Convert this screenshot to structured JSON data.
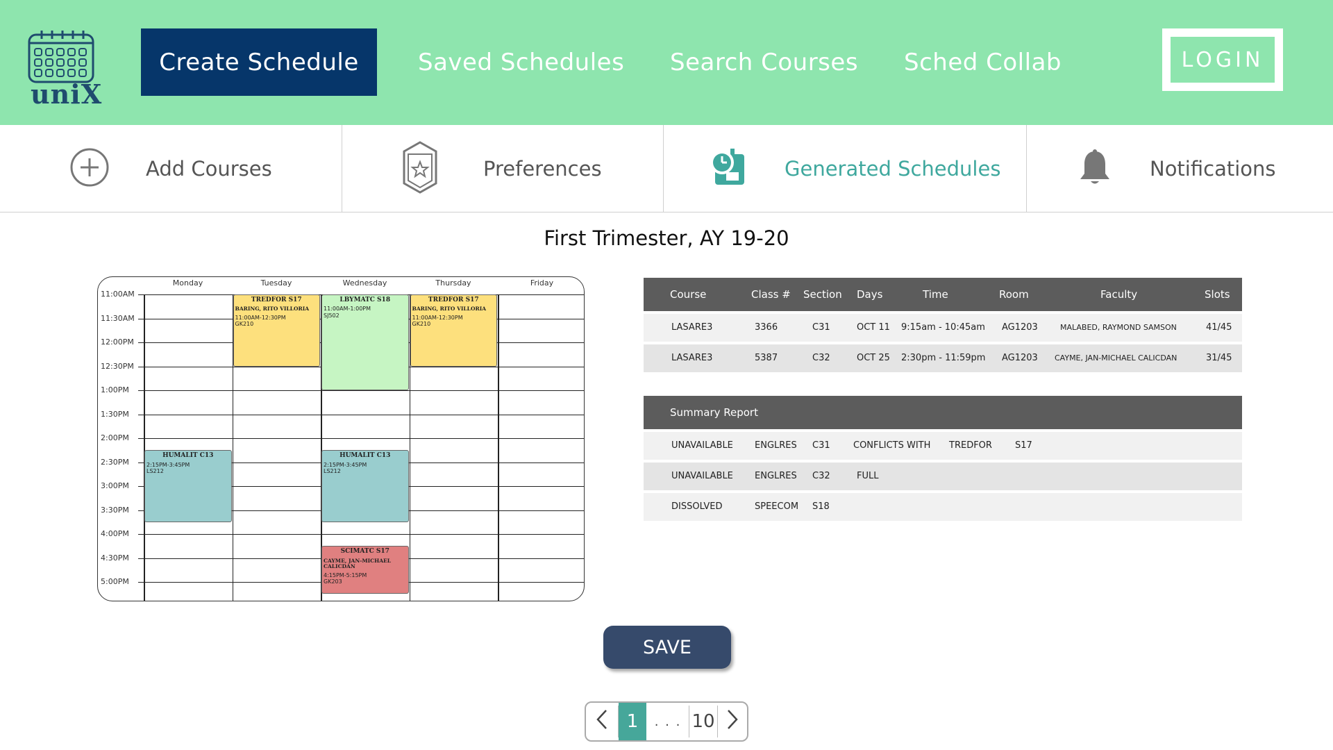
{
  "app": {
    "logo_text": "uniX"
  },
  "nav": {
    "create": "Create Schedule",
    "saved": "Saved Schedules",
    "search": "Search Courses",
    "collab": "Sched Collab",
    "login": "LOGIN"
  },
  "subtabs": {
    "add": "Add Courses",
    "preferences": "Preferences",
    "generated": "Generated Schedules",
    "notifications": "Notifications"
  },
  "trimester": "First Trimester, AY 19-20",
  "calendar": {
    "days": [
      "Monday",
      "Tuesday",
      "Wednesday",
      "Thursday",
      "Friday"
    ],
    "times": [
      "11:00AM",
      "11:30AM",
      "12:00PM",
      "12:30PM",
      "1:00PM",
      "1:30PM",
      "2:00PM",
      "2:30PM",
      "3:00PM",
      "3:30PM",
      "4:00PM",
      "4:30PM",
      "5:00PM"
    ],
    "events": [
      {
        "title": "TREDFOR S17",
        "faculty": "BARING, RITO VILLORIA",
        "time": "11:00AM-12:30PM",
        "room": "GK210",
        "color": "#fde07d"
      },
      {
        "title": "LBYMATC S18",
        "faculty": "",
        "time": "11:00AM-1:00PM",
        "room": "SJ502",
        "color": "#c6f5c3"
      },
      {
        "title": "TREDFOR S17",
        "faculty": "BARING, RITO VILLORIA",
        "time": "11:00AM-12:30PM",
        "room": "GK210",
        "color": "#fde07d"
      },
      {
        "title": "HUMALIT C13",
        "faculty": "",
        "time": "2:15PM-3:45PM",
        "room": "LS212",
        "color": "#99cdce"
      },
      {
        "title": "HUMALIT C13",
        "faculty": "",
        "time": "2:15PM-3:45PM",
        "room": "LS212",
        "color": "#99cdce"
      },
      {
        "title": "SCIMATC S17",
        "faculty": "CAYME, JAN-MICHAEL CALICDAN",
        "time": "4:15PM-5:15PM",
        "room": "GK203",
        "color": "#e08080"
      }
    ]
  },
  "courses_table": {
    "headers": [
      "Course",
      "Class #",
      "Section",
      "Days",
      "Time",
      "Room",
      "Faculty",
      "Slots"
    ],
    "rows": [
      [
        "LASARE3",
        "3366",
        "C31",
        "OCT 11",
        "9:15am - 10:45am",
        "AG1203",
        "MALABED, RAYMOND SAMSON",
        "41/45"
      ],
      [
        "LASARE3",
        "5387",
        "C32",
        "OCT 25",
        "2:30pm - 11:59pm",
        "AG1203",
        "CAYME, JAN-MICHAEL CALICDAN",
        "31/45"
      ]
    ]
  },
  "summary": {
    "title": "Summary Report",
    "rows": [
      [
        "UNAVAILABLE",
        "ENGLRES",
        "C31",
        "CONFLICTS WITH",
        "TREDFOR",
        "S17"
      ],
      [
        "UNAVAILABLE",
        "ENGLRES",
        "C32",
        "FULL",
        "",
        ""
      ],
      [
        "DISSOLVED",
        "SPEECOM",
        "S18",
        "",
        "",
        ""
      ]
    ]
  },
  "save_label": "SAVE",
  "pager": {
    "current": "1",
    "ellipsis": ". . .",
    "last": "10"
  },
  "colors": {
    "nav_bg": "#8ee5ae",
    "nav_active": "#06366a",
    "accent": "#3fa89e",
    "save": "#364a6b"
  }
}
